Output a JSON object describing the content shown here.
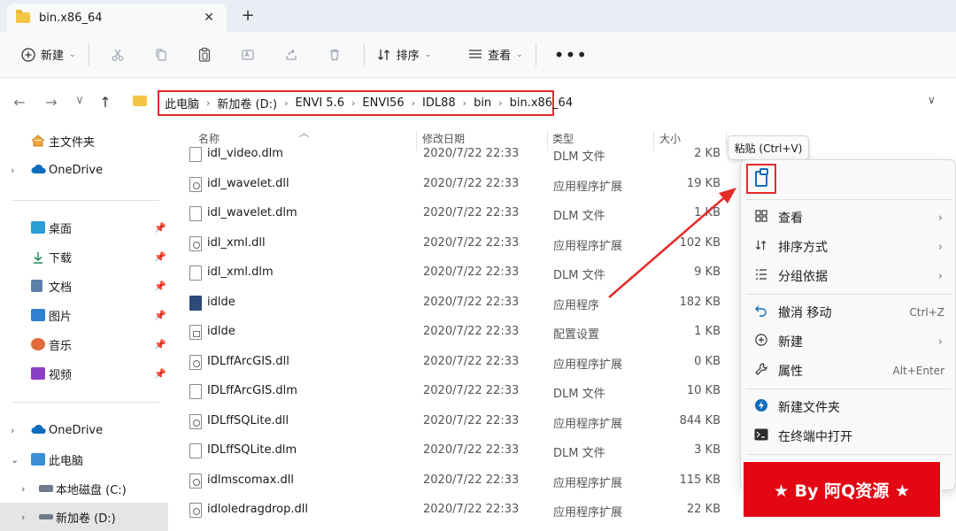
{
  "tab": {
    "title": "bin.x86_64",
    "close": "✕",
    "new": "+"
  },
  "toolbar": {
    "new_label": "新建",
    "sort_label": "排序",
    "view_label": "查看",
    "more": "•••"
  },
  "nav": {
    "back": "←",
    "forward": "→",
    "recent": "∨",
    "up": "↑"
  },
  "breadcrumb": [
    "此电脑",
    "新加卷 (D:)",
    "ENVI 5.6",
    "ENVI56",
    "IDL88",
    "bin",
    "bin.x86_64"
  ],
  "breadcrumb_sep": "›",
  "sidebar": {
    "home": "主文件夹",
    "onedrive1": "OneDrive",
    "desktop": "桌面",
    "downloads": "下载",
    "documents": "文档",
    "pictures": "图片",
    "music": "音乐",
    "videos": "视频",
    "onedrive2": "OneDrive",
    "thispc": "此电脑",
    "local_c": "本地磁盘 (C:)",
    "vol_d": "新加卷 (D:)"
  },
  "columns": {
    "name": "名称",
    "date": "修改日期",
    "type": "类型",
    "size": "大小"
  },
  "files": [
    {
      "name": "idl_video.dlm",
      "date": "2020/7/22 22:33",
      "type": "DLM 文件",
      "size": "2 KB",
      "icon": "file"
    },
    {
      "name": "idl_wavelet.dll",
      "date": "2020/7/22 22:33",
      "type": "应用程序扩展",
      "size": "19 KB",
      "icon": "dll"
    },
    {
      "name": "idl_wavelet.dlm",
      "date": "2020/7/22 22:33",
      "type": "DLM 文件",
      "size": "1 KB",
      "icon": "file"
    },
    {
      "name": "idl_xml.dll",
      "date": "2020/7/22 22:33",
      "type": "应用程序扩展",
      "size": "102 KB",
      "icon": "dll"
    },
    {
      "name": "idl_xml.dlm",
      "date": "2020/7/22 22:33",
      "type": "DLM 文件",
      "size": "9 KB",
      "icon": "file"
    },
    {
      "name": "idlde",
      "date": "2020/7/22 22:33",
      "type": "应用程序",
      "size": "182 KB",
      "icon": "exe"
    },
    {
      "name": "idlde",
      "date": "2020/7/22 22:33",
      "type": "配置设置",
      "size": "1 KB",
      "icon": "cfg"
    },
    {
      "name": "IDLffArcGIS.dll",
      "date": "2020/7/22 22:33",
      "type": "应用程序扩展",
      "size": "0 KB",
      "icon": "dll"
    },
    {
      "name": "IDLffArcGIS.dlm",
      "date": "2020/7/22 22:33",
      "type": "DLM 文件",
      "size": "10 KB",
      "icon": "file"
    },
    {
      "name": "IDLffSQLite.dll",
      "date": "2020/7/22 22:33",
      "type": "应用程序扩展",
      "size": "844 KB",
      "icon": "dll"
    },
    {
      "name": "IDLffSQLite.dlm",
      "date": "2020/7/22 22:33",
      "type": "DLM 文件",
      "size": "3 KB",
      "icon": "file"
    },
    {
      "name": "idlmscomax.dll",
      "date": "2020/7/22 22:33",
      "type": "应用程序扩展",
      "size": "115 KB",
      "icon": "dll"
    },
    {
      "name": "idloledragdrop.dll",
      "date": "2020/7/22 22:33",
      "type": "应用程序扩展",
      "size": "22 KB",
      "icon": "dll"
    }
  ],
  "tooltip": "粘贴 (Ctrl+V)",
  "context_menu": {
    "view": "查看",
    "sort": "排序方式",
    "group": "分组依据",
    "undo": "撤消 移动",
    "undo_shortcut": "Ctrl+Z",
    "new": "新建",
    "properties": "属性",
    "properties_shortcut": "Alt+Enter",
    "new_folder": "新建文件夹",
    "terminal": "在终端中打开"
  },
  "watermark": "★ By 阿Q资源 ★",
  "colors": {
    "highlight": "#e52a2a",
    "accent": "#0f6cbd",
    "watermark_bg": "#e30613"
  }
}
